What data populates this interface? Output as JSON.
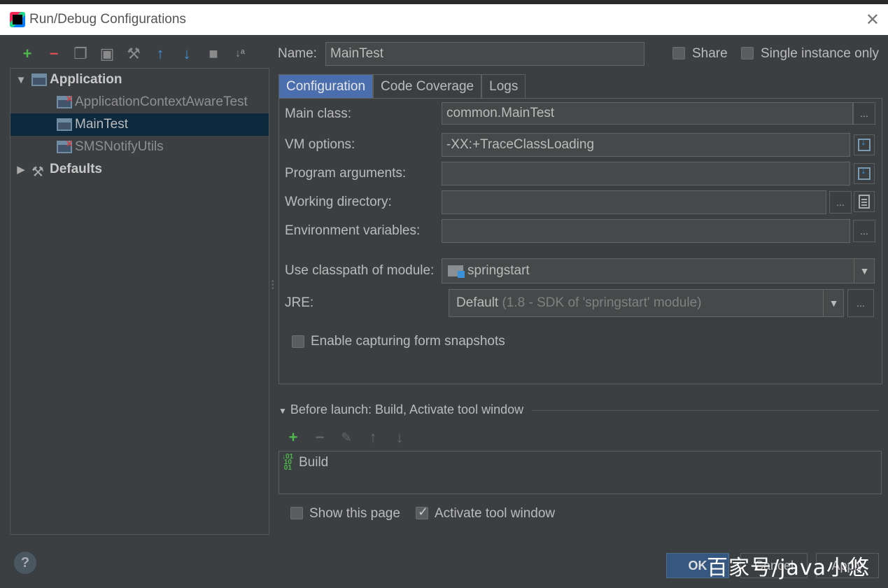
{
  "window": {
    "title": "Run/Debug Configurations"
  },
  "tree": {
    "application": "Application",
    "items": [
      "ApplicationContextAwareTest",
      "MainTest",
      "SMSNotifyUtils"
    ],
    "defaults": "Defaults"
  },
  "name_label": "Name:",
  "name_value": "MainTest",
  "share_label": "Share",
  "single_instance_label": "Single instance only",
  "tabs": [
    "Configuration",
    "Code Coverage",
    "Logs"
  ],
  "form": {
    "main_class_label": "Main class:",
    "main_class_value": "common.MainTest",
    "vm_options_label": "VM options:",
    "vm_options_value": "-XX:+TraceClassLoading",
    "program_arguments_label": "Program arguments:",
    "working_directory_label": "Working directory:",
    "environment_variables_label": "Environment variables:",
    "classpath_label": "Use classpath of module:",
    "classpath_value": "springstart",
    "jre_label": "JRE:",
    "jre_default": "Default",
    "jre_detail": "(1.8 - SDK of 'springstart' module)",
    "snapshots_label": "Enable capturing form snapshots",
    "ellipsis": "..."
  },
  "before_launch": {
    "title": "Before launch: Build, Activate tool window",
    "items": [
      "Build"
    ]
  },
  "show_page_label": "Show this page",
  "activate_tool_label": "Activate tool window",
  "buttons": {
    "ok": "OK",
    "cancel": "Cancel",
    "apply": "Apply",
    "help": "?"
  },
  "watermark": "百家号/java小悠"
}
